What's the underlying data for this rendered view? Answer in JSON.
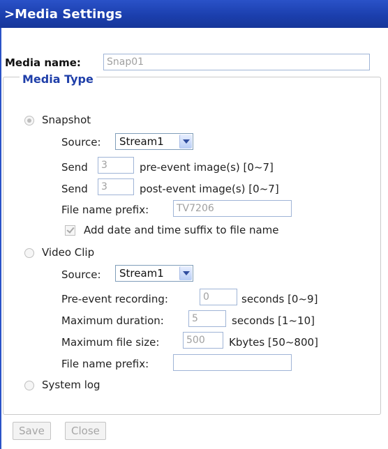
{
  "header": {
    "title": ">Media Settings"
  },
  "media_name": {
    "label": "Media name:",
    "value": "Snap01"
  },
  "media_type": {
    "legend": "Media Type",
    "snapshot": {
      "label": "Snapshot",
      "selected": true,
      "source_label": "Source:",
      "source_value": "Stream1",
      "send_label": "Send",
      "pre_event_value": "3",
      "pre_event_text": "pre-event image(s) [0~7]",
      "post_event_value": "3",
      "post_event_text": "post-event image(s) [0~7]",
      "prefix_label": "File name prefix:",
      "prefix_value": "TV7206",
      "suffix_label": "Add date and time suffix to file name",
      "suffix_checked": true
    },
    "video_clip": {
      "label": "Video Clip",
      "selected": false,
      "source_label": "Source:",
      "source_value": "Stream1",
      "pre_event_label": "Pre-event recording:",
      "pre_event_value": "0",
      "pre_event_unit": "seconds [0~9]",
      "max_duration_label": "Maximum duration:",
      "max_duration_value": "5",
      "max_duration_unit": "seconds [1~10]",
      "max_size_label": "Maximum file size:",
      "max_size_value": "500",
      "max_size_unit": "Kbytes [50~800]",
      "prefix_label": "File name prefix:",
      "prefix_value": ""
    },
    "system_log": {
      "label": "System log",
      "selected": false
    }
  },
  "buttons": {
    "save": "Save",
    "close": "Close"
  },
  "colors": {
    "header_bg": "#1b3fae",
    "legend_text": "#1f3fa9"
  }
}
